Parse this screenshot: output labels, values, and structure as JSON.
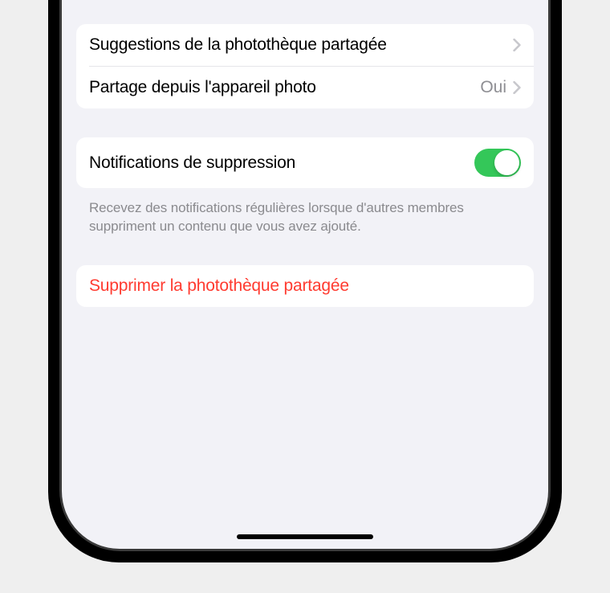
{
  "settings": {
    "group1": {
      "suggestions_label": "Suggestions de la photothèque partagée",
      "camera_sharing_label": "Partage depuis l'appareil photo",
      "camera_sharing_value": "Oui"
    },
    "group2": {
      "deletion_notifications_label": "Notifications de suppression",
      "deletion_notifications_on": true,
      "footer": "Recevez des notifications régulières lorsque d'autres membres suppriment un contenu que vous avez ajouté."
    },
    "group3": {
      "delete_library_label": "Supprimer la photothèque partagée"
    }
  },
  "colors": {
    "toggle_on": "#34c759",
    "destructive": "#ff3b30",
    "background": "#f2f2f7"
  }
}
